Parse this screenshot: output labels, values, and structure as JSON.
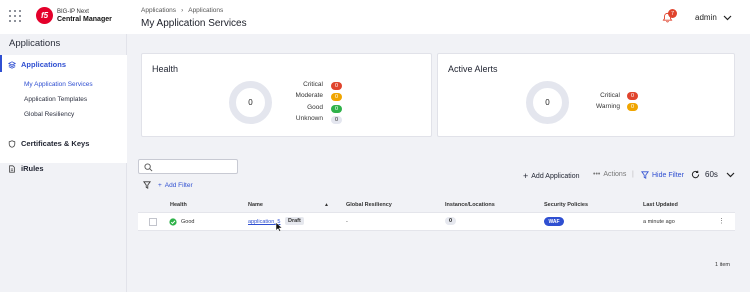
{
  "app": {
    "brand_line1": "BIG-IP Next",
    "brand_line2": "Central Manager",
    "logo_text": "f5",
    "breadcrumb": [
      "Applications",
      "Applications"
    ],
    "page_title": "My Application Services",
    "notifications_count": "7",
    "user_name": "admin"
  },
  "sidebar": {
    "title": "Applications",
    "items": [
      {
        "label": "Applications",
        "icon": "layers-icon",
        "subitems": [
          "My Application Services",
          "Application Templates",
          "Global Resiliency"
        ]
      },
      {
        "label": "Certificates & Keys",
        "icon": "shield-icon"
      },
      {
        "label": "iRules",
        "icon": "document-icon"
      }
    ]
  },
  "health": {
    "title": "Health",
    "total": "0",
    "legend": [
      {
        "label": "Critical",
        "count": "0",
        "color": "#e0442d"
      },
      {
        "label": "Moderate",
        "count": "0",
        "color": "#f0a500"
      },
      {
        "label": "Good",
        "count": "0",
        "color": "#2fb24a"
      },
      {
        "label": "Unknown",
        "count": "0",
        "color": "#e4e6ef"
      }
    ]
  },
  "alerts": {
    "title": "Active Alerts",
    "total": "0",
    "legend": [
      {
        "label": "Critical",
        "count": "0",
        "color": "#e0442d"
      },
      {
        "label": "Warning",
        "count": "0",
        "color": "#f0a500"
      }
    ]
  },
  "toolbar": {
    "add_filter": "Add Filter",
    "add_application": "Add Application",
    "actions": "Actions",
    "hide_filter": "Hide Filter",
    "refresh_interval": "60s"
  },
  "table": {
    "headers": [
      "Health",
      "Name",
      "Global Resiliency",
      "Instance/Locations",
      "Security Policies",
      "Last Updated"
    ],
    "rows": [
      {
        "health": "Good",
        "name": "application_5",
        "status": "Draft",
        "global_resiliency": "-",
        "instances": "0",
        "security": "WAF",
        "last_updated": "a minute ago"
      }
    ],
    "count_text": "1 item"
  },
  "colors": {
    "accent": "#2f4fd1",
    "critical": "#e0442d",
    "warning": "#f0a500",
    "good": "#2fb24a"
  }
}
